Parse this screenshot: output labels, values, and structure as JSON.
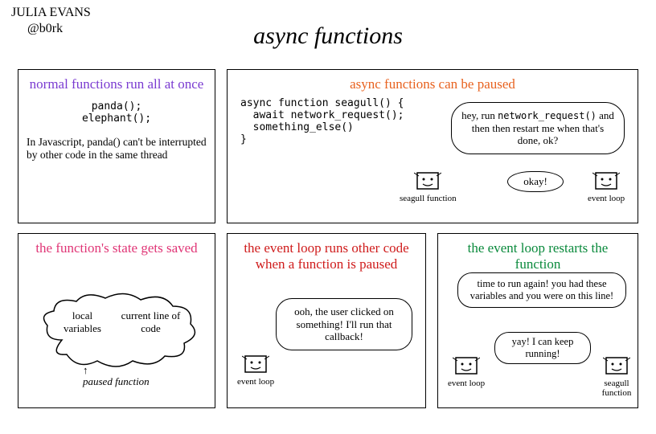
{
  "author_name": "JULIA EVANS",
  "author_handle": "@b0rk",
  "main_title": "async functions",
  "panel1": {
    "title": "normal functions run all at once",
    "code": "panda();\nelephant();",
    "body": "In Javascript, panda() can't be interrupted by other code in the same thread"
  },
  "panel2": {
    "title": "async functions can be paused",
    "code": "async function seagull() {\n  await network_request();\n  something_else()\n}",
    "bubble1_pre": "hey, run ",
    "bubble1_code": "network_request()",
    "bubble1_post": " and then then restart me when that's done, ok?",
    "bubble2": "okay!",
    "char1_label": "seagull function",
    "char2_label": "event loop"
  },
  "panel3": {
    "title": "the function's state gets saved",
    "cloud_left": "local variables",
    "cloud_right": "current line of code",
    "cloud_label": "paused function"
  },
  "panel4": {
    "title": "the event loop runs other code when a function is paused",
    "bubble": "ooh, the user clicked on something! I'll run that callback!",
    "char_label": "event loop"
  },
  "panel5": {
    "title": "the event loop restarts the function",
    "bubble1": "time to run again! you had these variables and you were on this line!",
    "bubble2": "yay! I can keep running!",
    "char1_label": "event loop",
    "char2_label": "seagull function"
  }
}
